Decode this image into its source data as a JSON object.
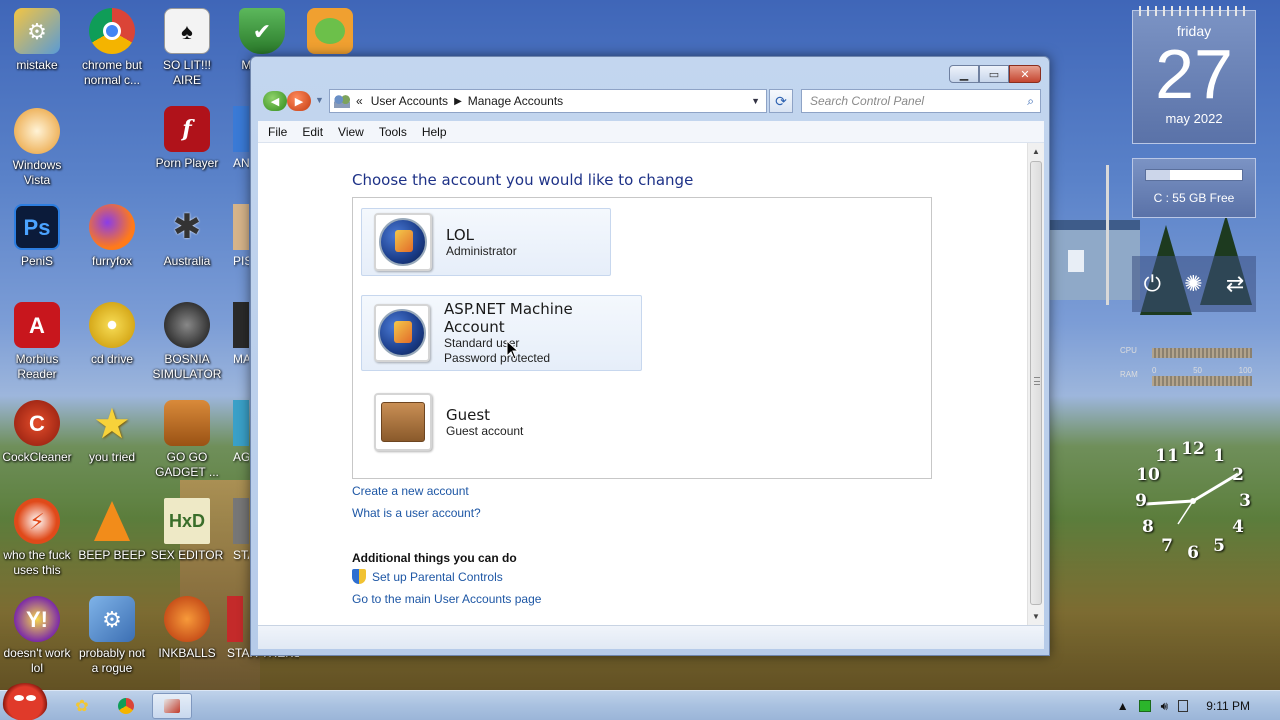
{
  "desktop": {
    "icons": [
      {
        "label": "mistake"
      },
      {
        "label": "chrome but normal c..."
      },
      {
        "label": "SO LIT!!! AIRE"
      },
      {
        "label": "M... B..."
      },
      {
        "label": "Windows Vista"
      },
      {
        "label": "Porn Player"
      },
      {
        "label": "ANG..."
      },
      {
        "label": "PeniS"
      },
      {
        "label": "furryfox"
      },
      {
        "label": "Australia"
      },
      {
        "label": "PIS... AVIA..."
      },
      {
        "label": "Morbius Reader"
      },
      {
        "label": "cd drive"
      },
      {
        "label": "BOSNIA SIMULATOR"
      },
      {
        "label": "MA... UN..."
      },
      {
        "label": "CockCleaner"
      },
      {
        "label": "you tried"
      },
      {
        "label": "GO GO GADGET ..."
      },
      {
        "label": "AGO... CHIC..."
      },
      {
        "label": "who the fuck uses this"
      },
      {
        "label": "BEEP BEEP"
      },
      {
        "label": "SEX EDITOR"
      },
      {
        "label": "STA... C..."
      },
      {
        "label": "doesn't work lol"
      },
      {
        "label": "probably not a rogue"
      },
      {
        "label": "INKBALLS"
      },
      {
        "label": "STAR TREKS"
      }
    ]
  },
  "gadgets": {
    "calendar": {
      "day": "friday",
      "date": "27",
      "month": "may 2022"
    },
    "drive": {
      "label": "C : 55 GB Free",
      "used_fraction": 0.25
    },
    "meter": {
      "cpu_label": "CPU",
      "ram_label": "RAM",
      "scale": [
        "0",
        "50",
        "100"
      ]
    },
    "clock": {
      "numbers": [
        "12",
        "1",
        "2",
        "3",
        "4",
        "5",
        "6",
        "7",
        "8",
        "9",
        "10",
        "11"
      ]
    }
  },
  "window": {
    "address": {
      "prefix": "«",
      "crumbs": [
        "User Accounts",
        "Manage Accounts"
      ]
    },
    "search_placeholder": "Search Control Panel",
    "menu": [
      "File",
      "Edit",
      "View",
      "Tools",
      "Help"
    ],
    "heading": "Choose the account you would like to change",
    "accounts": [
      {
        "name": "LOL",
        "lines": [
          "Administrator"
        ]
      },
      {
        "name": "ASP.NET Machine Account",
        "lines": [
          "Standard user",
          "Password protected"
        ]
      },
      {
        "name": "Guest",
        "lines": [
          "Guest account"
        ]
      }
    ],
    "links": {
      "create": "Create a new account",
      "what_is": "What is a user account?",
      "additional_heading": "Additional things you can do",
      "parental": "Set up Parental Controls",
      "main_page": "Go to the main User Accounts page"
    }
  },
  "taskbar": {
    "time": "9:11 PM"
  }
}
